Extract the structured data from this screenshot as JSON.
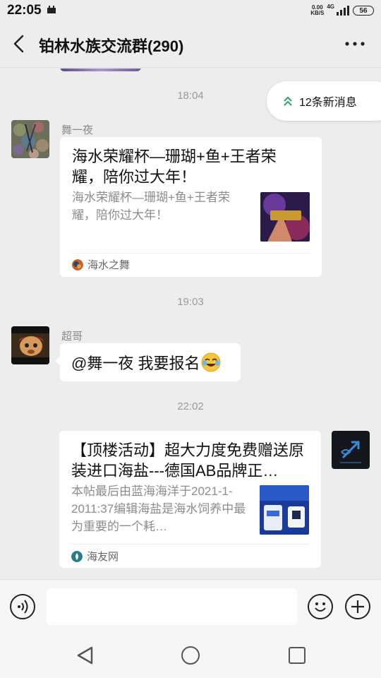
{
  "status_bar": {
    "time": "22:05",
    "net_speed_value": "0.00",
    "net_speed_unit": "KB/S",
    "network": "4G",
    "battery": "56"
  },
  "header": {
    "title": "铂林水族交流群(290)"
  },
  "new_messages": {
    "label": "12条新消息"
  },
  "messages": [
    {
      "type": "time",
      "text": "18:04"
    },
    {
      "type": "link-card",
      "sender": "舞一夜",
      "title": "海水荣耀杯—珊瑚+鱼+王者荣耀，陪你过大年！",
      "description": "海水荣耀杯—珊瑚+鱼+王者荣耀，陪你过大年！",
      "source": "海水之舞",
      "thumb_text": "海水荣耀"
    },
    {
      "type": "time",
      "text": "19:03"
    },
    {
      "type": "text",
      "sender": "超哥",
      "text": "@舞一夜  我要报名"
    },
    {
      "type": "time",
      "text": "22:02"
    },
    {
      "type": "link-card",
      "sender": "",
      "title": "【顶楼活动】超大力度免费赠送原装进口海盐---德国AB品牌正…",
      "description": "本帖最后由蓝海海洋于2021-1-2011:37编辑海盐是海水饲养中最为重要的一个耗…",
      "source": "海友网"
    }
  ],
  "input": {
    "placeholder": ""
  }
}
